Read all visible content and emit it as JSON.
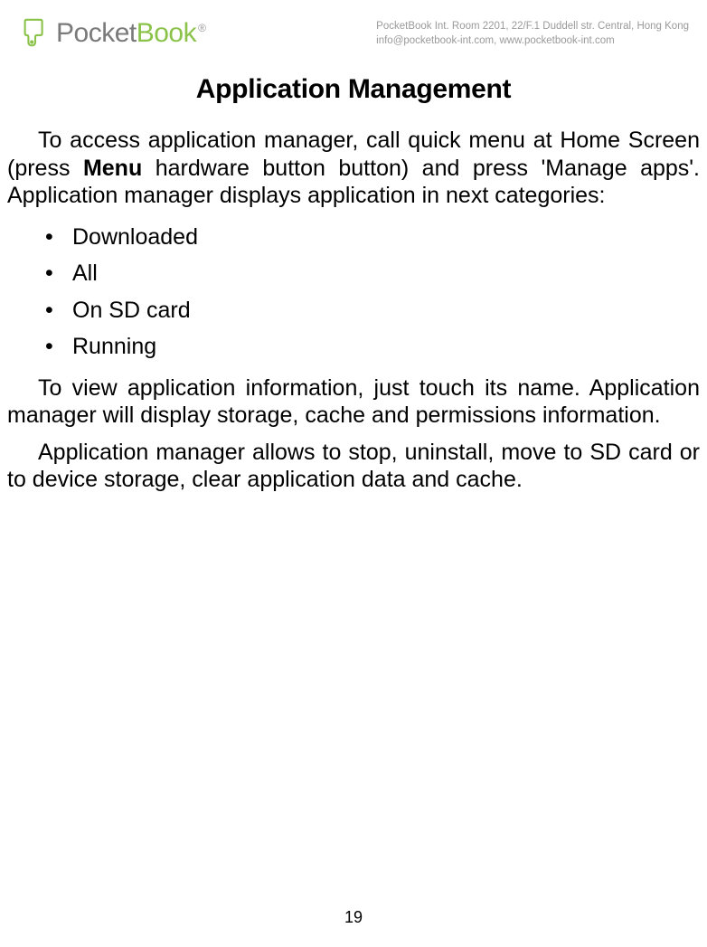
{
  "header": {
    "logo": {
      "pocket": "Pocket",
      "book": "Book",
      "registered": "®"
    },
    "company_line1": "PocketBook Int. Room 2201, 22/F.1 Duddell str. Central, Hong Kong",
    "company_line2": "info@pocketbook-int.com, www.pocketbook-int.com"
  },
  "document": {
    "title": "Application Management",
    "para1_pre": "To access application manager, call quick menu at Home Screen (press ",
    "para1_bold": "Menu",
    "para1_post": " hardware button button) and press 'Manage apps'. Application manager displays application in next categories:",
    "categories": [
      "Downloaded",
      "All",
      "On SD card",
      "Running"
    ],
    "para2": "To view application information, just touch its name. Application manager will display storage, cache and permissions information.",
    "para3": "Application manager allows to stop, uninstall, move to SD card or to device storage, clear application data and cache.",
    "page_number": "19"
  }
}
